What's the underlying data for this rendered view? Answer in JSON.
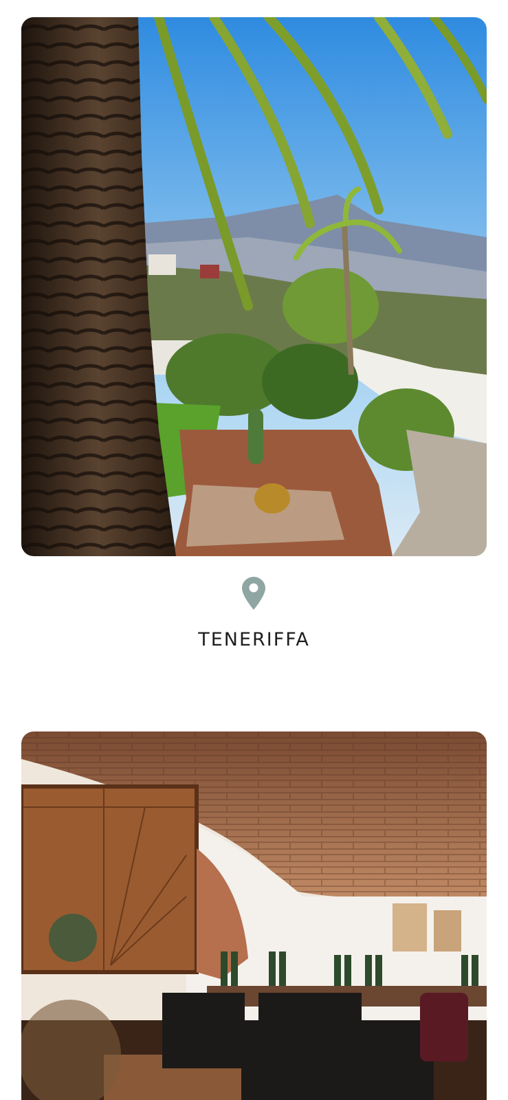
{
  "destinations": [
    {
      "label": "TENERIFFA",
      "image": "tenerife-garden-palm-view",
      "icon": "map-pin-icon"
    },
    {
      "label": "",
      "image": "wine-cellar-vaulted-brick"
    }
  ],
  "colors": {
    "pin": "#8fa6a3",
    "label_text": "#1e1e1e",
    "background": "#ffffff"
  }
}
